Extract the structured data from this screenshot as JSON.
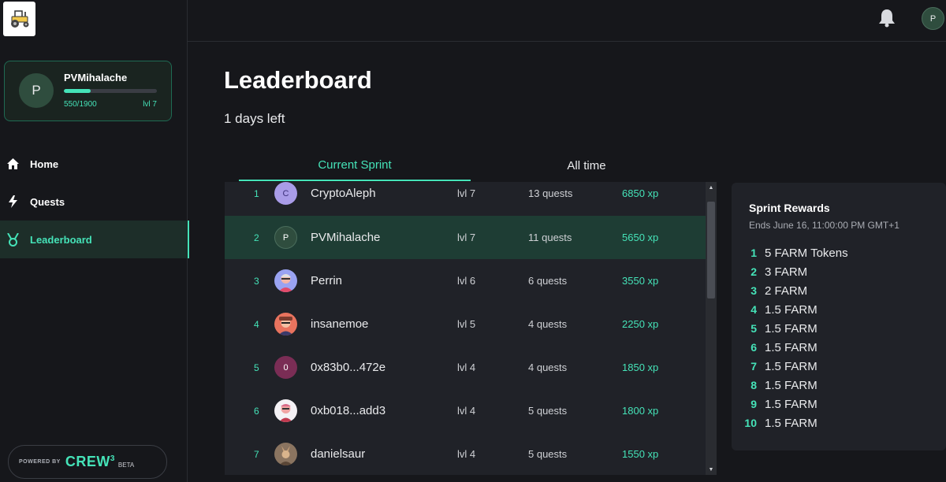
{
  "sidebar": {
    "profile": {
      "initial": "P",
      "name": "PVMihalache",
      "xp_text": "550/1900",
      "xp_progress": 0.29,
      "level": "lvl 7"
    },
    "nav": [
      {
        "label": "Home",
        "icon": "home-icon"
      },
      {
        "label": "Quests",
        "icon": "lightning-icon"
      },
      {
        "label": "Leaderboard",
        "icon": "medal-icon",
        "active": true
      }
    ],
    "powered": {
      "prefix": "POWERED BY",
      "brand": "CREW",
      "brand_sup": "3",
      "tag": "BETA"
    }
  },
  "topbar": {
    "avatar_initial": "P"
  },
  "main": {
    "title": "Leaderboard",
    "days_left": "1 days left",
    "tabs": [
      {
        "label": "Current Sprint",
        "active": true
      },
      {
        "label": "All time",
        "active": false
      }
    ]
  },
  "leaderboard": {
    "rows": [
      {
        "rank": "1",
        "initial": "C",
        "name": "CryptoAleph",
        "level": "lvl 7",
        "quests": "13 quests",
        "xp": "6850 xp"
      },
      {
        "rank": "2",
        "initial": "P",
        "name": "PVMihalache",
        "level": "lvl 7",
        "quests": "11 quests",
        "xp": "5650 xp"
      },
      {
        "rank": "3",
        "initial": "",
        "name": "Perrin",
        "level": "lvl 6",
        "quests": "6 quests",
        "xp": "3550 xp"
      },
      {
        "rank": "4",
        "initial": "",
        "name": "insanemoe",
        "level": "lvl 5",
        "quests": "4 quests",
        "xp": "2250 xp"
      },
      {
        "rank": "5",
        "initial": "0",
        "name": "0x83b0...472e",
        "level": "lvl 4",
        "quests": "4 quests",
        "xp": "1850 xp"
      },
      {
        "rank": "6",
        "initial": "",
        "name": "0xb018...add3",
        "level": "lvl 4",
        "quests": "5 quests",
        "xp": "1800 xp"
      },
      {
        "rank": "7",
        "initial": "",
        "name": "danielsaur",
        "level": "lvl 4",
        "quests": "5 quests",
        "xp": "1550 xp"
      }
    ]
  },
  "rewards": {
    "title": "Sprint Rewards",
    "ends": "Ends June 16, 11:00:00 PM GMT+1",
    "items": [
      {
        "rank": "1",
        "prize": "5 FARM Tokens"
      },
      {
        "rank": "2",
        "prize": "3 FARM"
      },
      {
        "rank": "3",
        "prize": "2 FARM"
      },
      {
        "rank": "4",
        "prize": "1.5 FARM"
      },
      {
        "rank": "5",
        "prize": "1.5 FARM"
      },
      {
        "rank": "6",
        "prize": "1.5 FARM"
      },
      {
        "rank": "7",
        "prize": "1.5 FARM"
      },
      {
        "rank": "8",
        "prize": "1.5 FARM"
      },
      {
        "rank": "9",
        "prize": "1.5 FARM"
      },
      {
        "rank": "10",
        "prize": "1.5 FARM"
      }
    ]
  },
  "colors": {
    "accent": "#45e3b8",
    "background": "#16171b",
    "panel": "#202228",
    "highlight": "#1e3d34"
  }
}
